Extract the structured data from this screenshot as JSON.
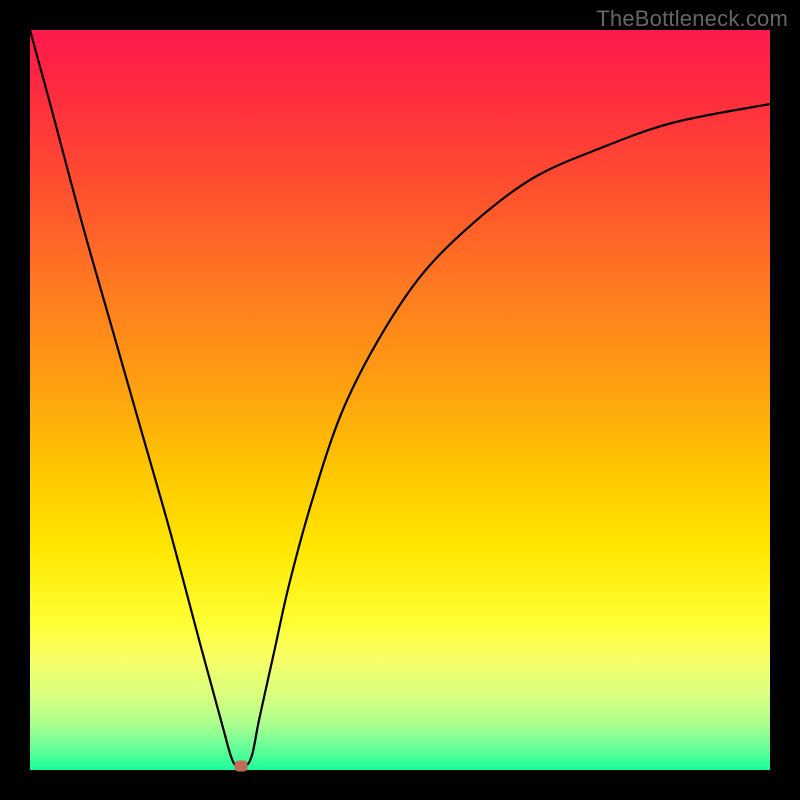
{
  "watermark": "TheBottleneck.com",
  "chart_data": {
    "type": "line",
    "title": "",
    "xlabel": "",
    "ylabel": "",
    "grid": false,
    "x_range": [
      0,
      100
    ],
    "y_range": [
      0,
      100
    ],
    "series": [
      {
        "name": "bottleneck-curve",
        "x": [
          0,
          3,
          7,
          11,
          15,
          19,
          23,
          26,
          27.5,
          29,
          30,
          31,
          33,
          35,
          38,
          42,
          47,
          53,
          60,
          68,
          77,
          87,
          100
        ],
        "y": [
          100,
          89,
          74,
          60,
          46,
          32,
          17,
          6,
          1,
          0.5,
          2,
          7,
          16,
          25,
          36,
          48,
          58,
          67,
          74,
          80,
          84,
          87.5,
          90
        ]
      }
    ],
    "marker": {
      "name": "optimal-point",
      "x": 28.5,
      "y": 0.5,
      "color": "#c46a5a"
    },
    "background_gradient": {
      "top": "#ff1a4d",
      "bottom": "#1aff99",
      "meaning": "red (worst) to green (best)"
    }
  }
}
